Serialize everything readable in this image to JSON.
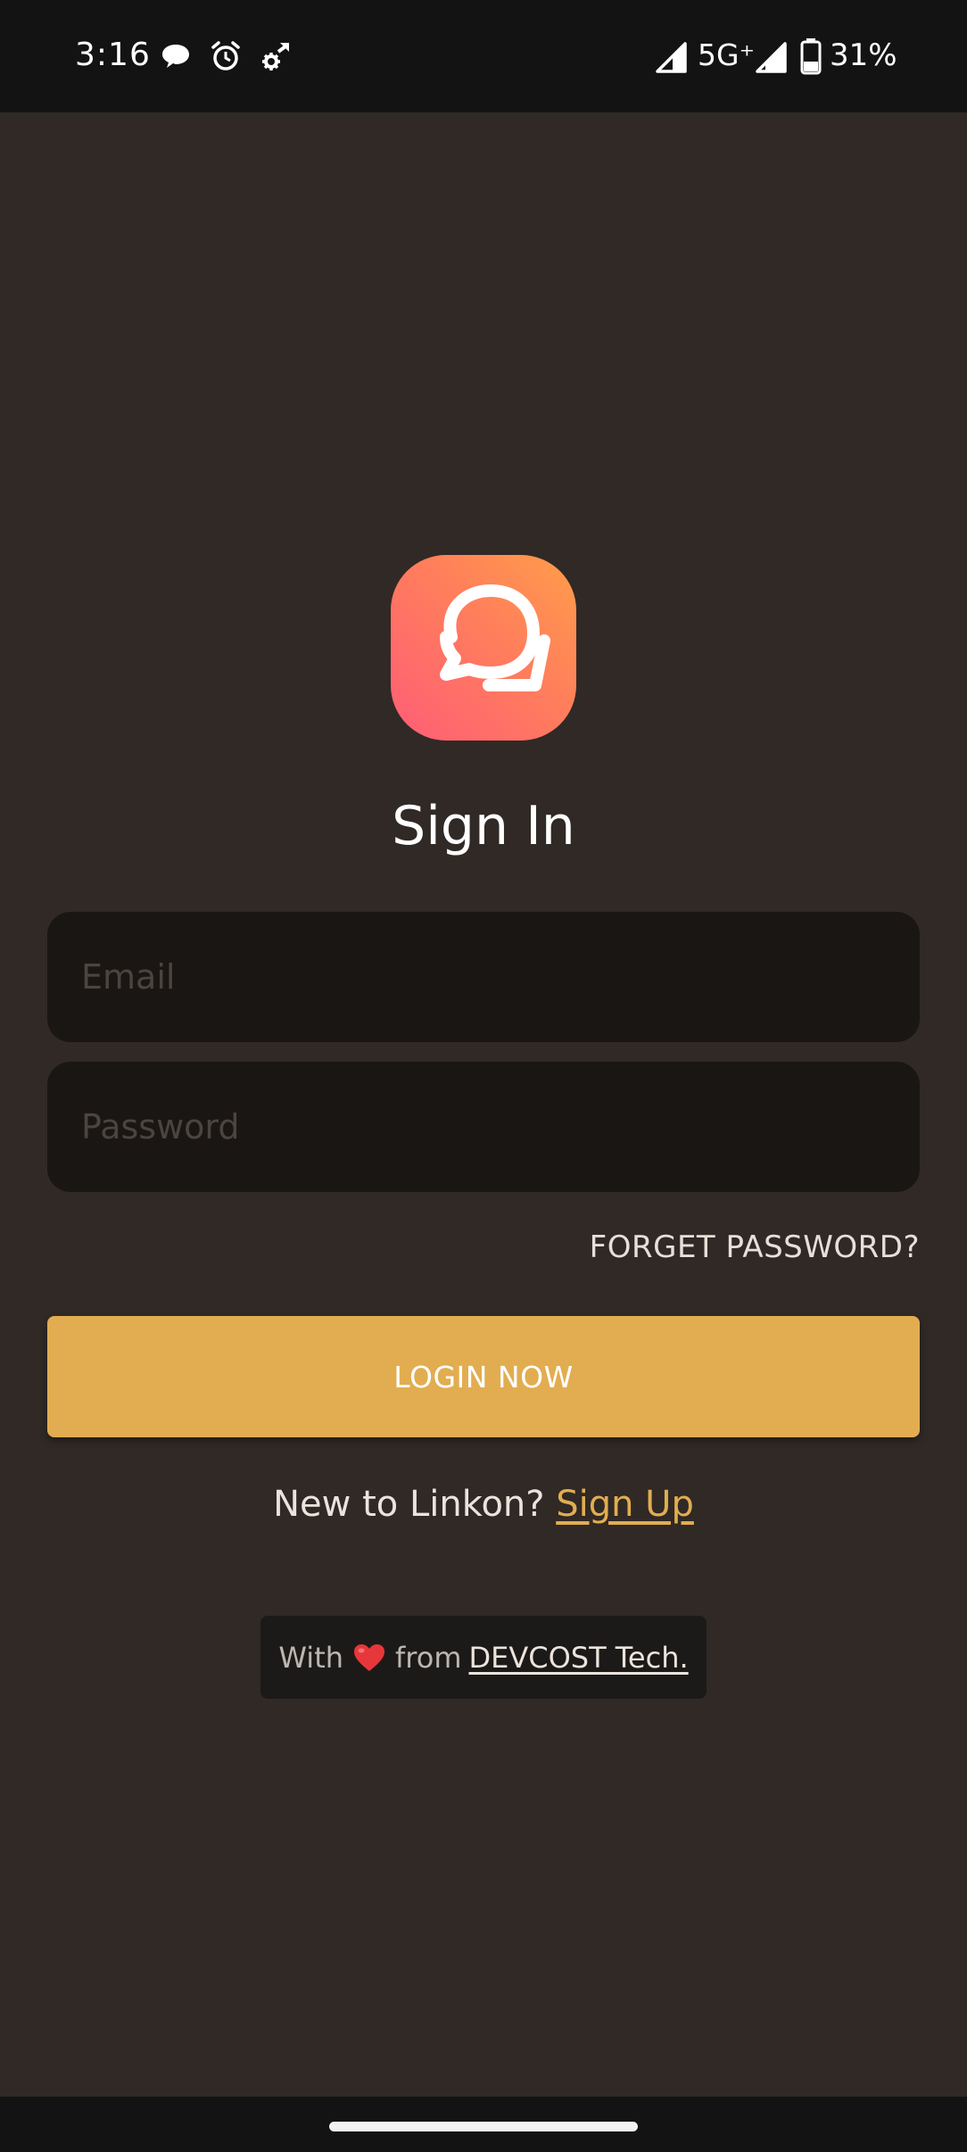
{
  "status_bar": {
    "time": "3:16",
    "network": "5G⁺",
    "battery": "31%",
    "icons": [
      "chat-bubble-icon",
      "alarm-icon",
      "settings-sync-icon",
      "signal-icon",
      "battery-icon"
    ]
  },
  "app": {
    "logo_icon": "chat-bubbles-icon",
    "logo_colors": [
      "#ff9d4a",
      "#ff5d76"
    ]
  },
  "signin": {
    "title": "Sign In",
    "email_placeholder": "Email",
    "password_placeholder": "Password",
    "forgot_label": "FORGET PASSWORD?",
    "login_label": "LOGIN NOW",
    "new_prompt": "New to Linkon?",
    "signup_label": "Sign Up"
  },
  "credit": {
    "prefix": "With",
    "heart": "heart-icon",
    "middle": "from",
    "company": "DEVCOST Tech."
  },
  "colors": {
    "background": "#302925",
    "accent": "#e2ad50",
    "field": "#1a1614"
  }
}
